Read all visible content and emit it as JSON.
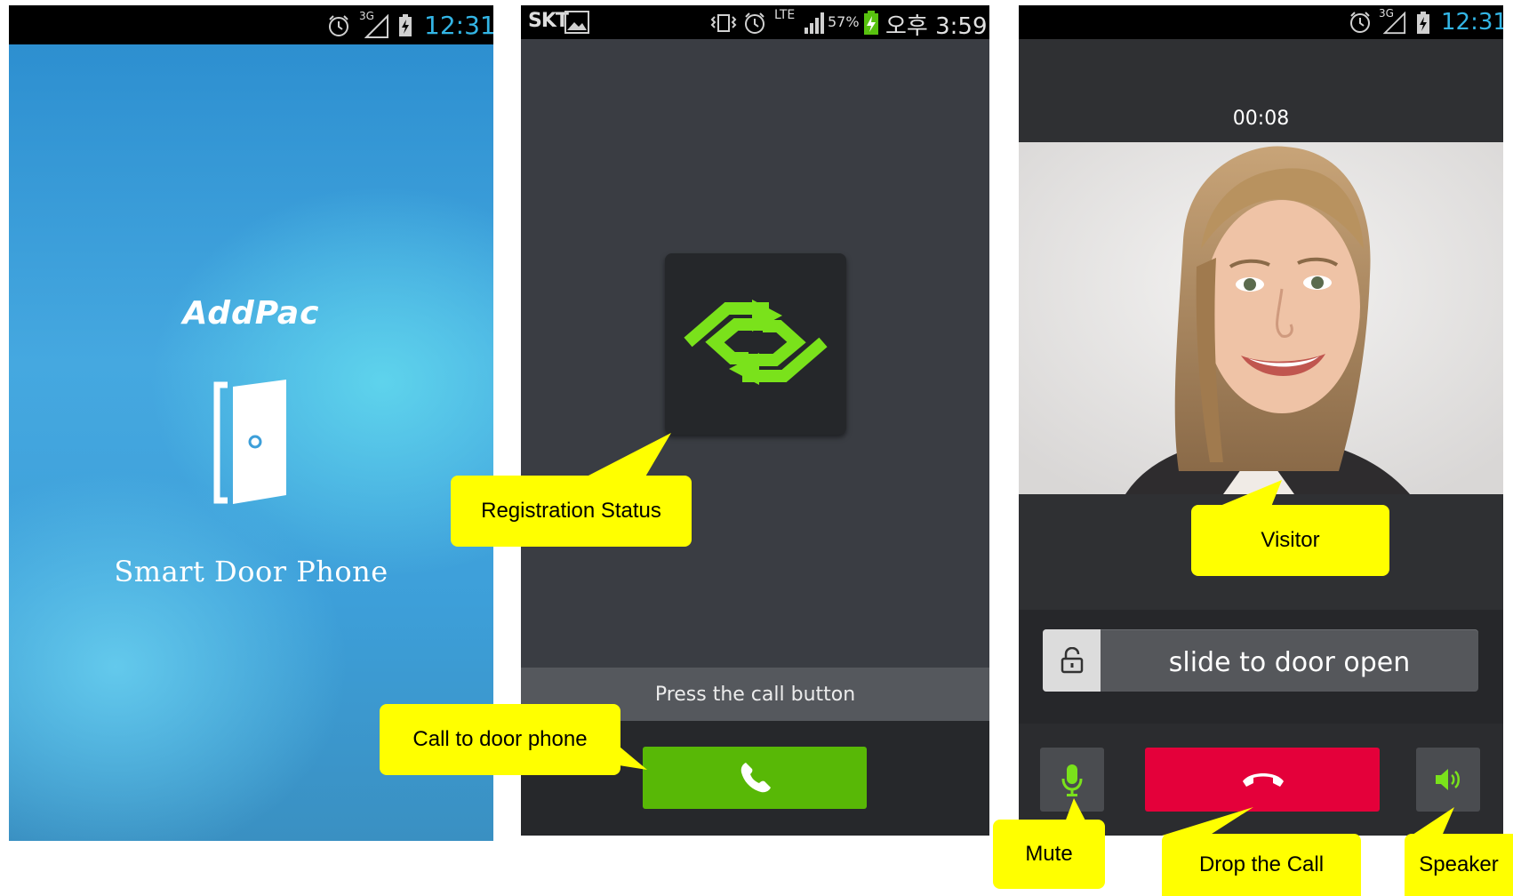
{
  "screen1": {
    "status": {
      "time": "12:31",
      "network": "3G"
    },
    "logo": "AddPac",
    "app_title": "Smart Door Phone",
    "icons": [
      "alarm-icon",
      "signal-3g-icon",
      "battery-charging-icon",
      "door-icon"
    ]
  },
  "screen2": {
    "status": {
      "carrier": "SKT",
      "battery": "57%",
      "network": "LTE",
      "time": "오후 3:59"
    },
    "prompt": "Press the call button",
    "icons": [
      "image-icon",
      "vibrate-icon",
      "alarm-icon",
      "signal-icon",
      "battery-charging-icon",
      "registration-sync-icon",
      "phone-icon"
    ]
  },
  "screen3": {
    "status": {
      "time": "12:31",
      "network": "3G"
    },
    "call_timer": "00:08",
    "slider_label": "slide to door open",
    "icons": [
      "alarm-icon",
      "lock-icon",
      "microphone-icon",
      "hang-up-icon",
      "speaker-icon"
    ]
  },
  "callouts": {
    "registration_status": "Registration Status",
    "call_to_door_phone": "Call to door phone",
    "visitor": "Visitor",
    "mute": "Mute",
    "drop_the_call": "Drop the Call",
    "speaker": "Speaker"
  },
  "colors": {
    "accent_blue": "#33b5e5",
    "call_green": "#58b806",
    "sync_green": "#7ae21b",
    "drop_red": "#e4003a",
    "callout_yellow": "#ffff00"
  }
}
